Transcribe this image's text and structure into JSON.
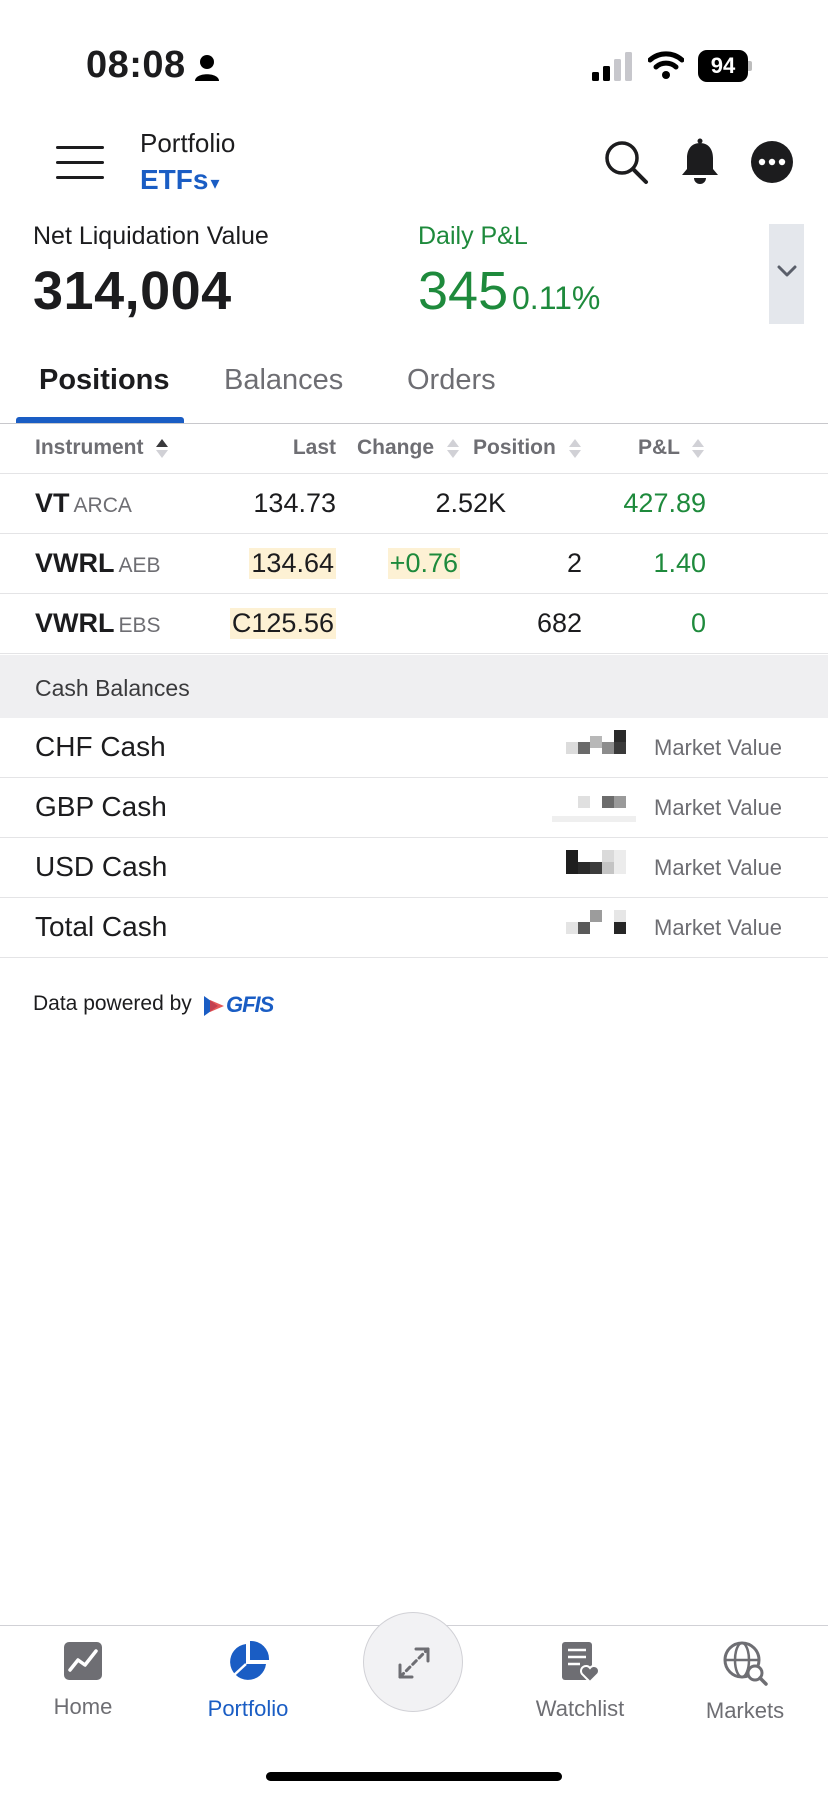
{
  "status_bar": {
    "time": "08:08",
    "battery": "94"
  },
  "header": {
    "section": "Portfolio",
    "account": "ETFs",
    "account_caret": "▾"
  },
  "summary": {
    "nlv_label": "Net Liquidation Value",
    "nlv_value": "314,004",
    "pnl_label": "Daily P&L",
    "pnl_value": "345",
    "pnl_pct": "0.11%"
  },
  "tabs": [
    "Positions",
    "Balances",
    "Orders"
  ],
  "positions": {
    "columns": [
      "Instrument",
      "Last",
      "Change",
      "Position",
      "P&L"
    ],
    "rows": [
      {
        "symbol": "VT",
        "exchange": "ARCA",
        "last": "134.73",
        "change": "",
        "position": "2.52K",
        "pnl": "427.89"
      },
      {
        "symbol": "VWRL",
        "exchange": "AEB",
        "last": "134.64",
        "change": "+0.76",
        "position": "2",
        "pnl": "1.40"
      },
      {
        "symbol": "VWRL",
        "exchange": "EBS",
        "last": "C125.56",
        "change": "",
        "position": "682",
        "pnl": "0"
      }
    ]
  },
  "cash": {
    "section_title": "Cash Balances",
    "rows": [
      {
        "name": "CHF Cash",
        "value_label": "Market Value"
      },
      {
        "name": "GBP Cash",
        "value_label": "Market Value"
      },
      {
        "name": "USD Cash",
        "value_label": "Market Value"
      },
      {
        "name": "Total Cash",
        "value_label": "Market Value"
      }
    ]
  },
  "credit": {
    "text": "Data powered by",
    "logo": "GFIS"
  },
  "nav": [
    {
      "label": "Home",
      "icon": "chart-home-icon"
    },
    {
      "label": "Portfolio",
      "icon": "pie-chart-icon"
    },
    {
      "label": "Watchlist",
      "icon": "watchlist-icon"
    },
    {
      "label": "Markets",
      "icon": "globe-search-icon"
    }
  ],
  "colors": {
    "accent": "#1a5dc4",
    "positive": "#1e8a3c",
    "highlight": "#fdf1d4"
  }
}
